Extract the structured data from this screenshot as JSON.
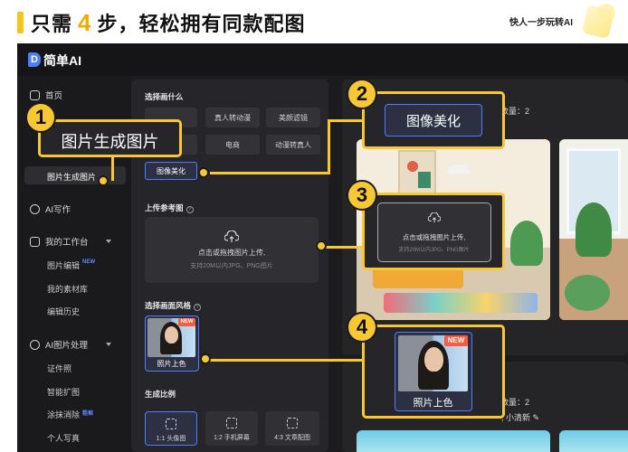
{
  "banner": {
    "headline_before": "只需",
    "headline_number": "4",
    "headline_after": "步，轻松拥有同款配图",
    "tagline": "快人一步玩转AI"
  },
  "app": {
    "logo_letter": "D",
    "brand": "简单AI"
  },
  "sidebar": {
    "home": "首页",
    "image_gen_active": "图片生成图片",
    "ai_writing": "AI写作",
    "workspace": "我的工作台",
    "workspace_items": [
      {
        "label": "图片编辑",
        "badge": "NEW"
      },
      {
        "label": "我的素材库",
        "badge": ""
      },
      {
        "label": "编辑历史",
        "badge": ""
      }
    ],
    "ai_image": "AI图片处理",
    "ai_image_items": [
      {
        "label": "证件照",
        "badge": ""
      },
      {
        "label": "智能扩图",
        "badge": ""
      },
      {
        "label": "涂抹消除",
        "badge": "粗框"
      },
      {
        "label": "个人写真",
        "badge": ""
      }
    ]
  },
  "panel": {
    "choose_style_title": "选择画什么",
    "chips": [
      "",
      "真人转动漫",
      "美颜滤镜",
      "",
      "电商",
      "动漫转真人",
      "图像美化"
    ],
    "upload_title": "上传参考图",
    "upload_main": "点击或拖拽图片上传,",
    "upload_hint": "支持20M以内JPG、PNG图片",
    "style_title": "选择画面风格",
    "style_card_label": "照片上色",
    "style_card_badge": "NEW",
    "ratio_title": "生成比例",
    "ratios": [
      "1:1 头像图",
      "1:2 手机屏幕",
      "4:3 文章配图"
    ]
  },
  "gallery": {
    "count_text_1": "数量：2",
    "count_text_2": "数量：2",
    "prompt_fragment": ", 小清新"
  },
  "callouts": {
    "step1": {
      "number": "1",
      "label": "图片生成图片"
    },
    "step2": {
      "number": "2",
      "label": "图像美化"
    },
    "step3": {
      "number": "3",
      "main": "点击或拖拽图片上传,",
      "hint": "支持20M以内JPG、PNG图片"
    },
    "step4": {
      "number": "4",
      "label": "照片上色",
      "badge": "NEW"
    }
  },
  "colors": {
    "accent_yellow": "#f7c833",
    "brand_blue": "#4d7cff",
    "badge_red": "#ff5a3c"
  }
}
